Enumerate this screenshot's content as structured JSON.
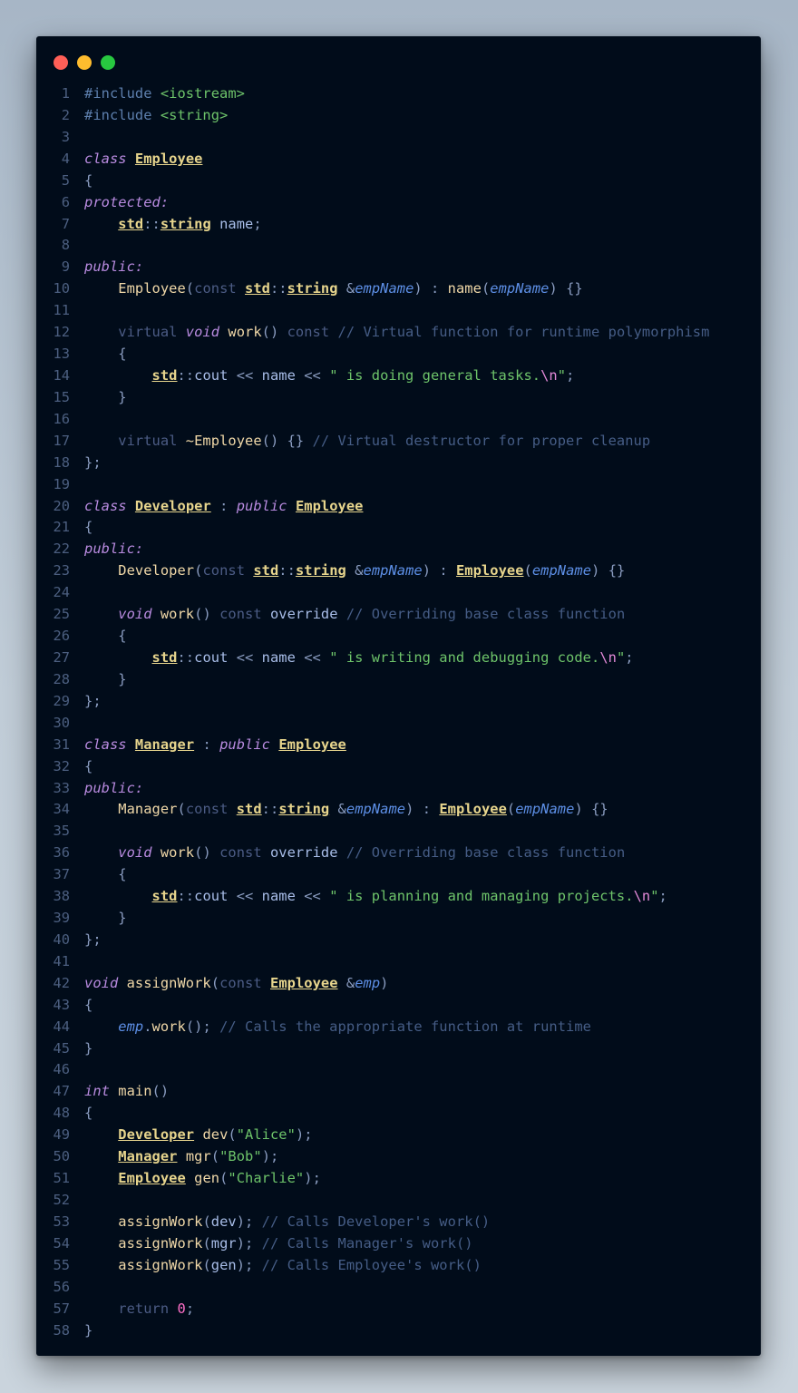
{
  "window": {
    "controls": [
      "close",
      "minimize",
      "maximize"
    ]
  },
  "colors": {
    "keyword": "#b98be0",
    "type": "#e7d58d",
    "string": "#6ec46a",
    "comment": "#465d86",
    "line_number": "#4c5f80",
    "background": "#010c1a"
  },
  "code": {
    "language": "C++",
    "lines": [
      [
        [
          "pp",
          "#include "
        ],
        [
          "inc",
          "<iostream>"
        ]
      ],
      [
        [
          "pp",
          "#include "
        ],
        [
          "inc",
          "<string>"
        ]
      ],
      [],
      [
        [
          "kw",
          "class"
        ],
        [
          "sp",
          " "
        ],
        [
          "ty",
          "Employee"
        ]
      ],
      [
        [
          "pu",
          "{"
        ]
      ],
      [
        [
          "kw",
          "protected:"
        ]
      ],
      [
        [
          "sp",
          "    "
        ],
        [
          "ty",
          "std"
        ],
        [
          "pu",
          "::"
        ],
        [
          "ty",
          "string"
        ],
        [
          "va",
          " name"
        ],
        [
          "pu",
          ";"
        ]
      ],
      [],
      [
        [
          "kw",
          "public:"
        ]
      ],
      [
        [
          "sp",
          "    "
        ],
        [
          "fn",
          "Employee"
        ],
        [
          "pu",
          "("
        ],
        [
          "kw2",
          "const "
        ],
        [
          "ty",
          "std"
        ],
        [
          "pu",
          "::"
        ],
        [
          "ty",
          "string"
        ],
        [
          "sp",
          " "
        ],
        [
          "pu",
          "&"
        ],
        [
          "pa",
          "empName"
        ],
        [
          "pu",
          ") : "
        ],
        [
          "fn",
          "name"
        ],
        [
          "pu",
          "("
        ],
        [
          "pa",
          "empName"
        ],
        [
          "pu",
          ") {}"
        ]
      ],
      [],
      [
        [
          "sp",
          "    "
        ],
        [
          "kw2",
          "virtual "
        ],
        [
          "kw",
          "void"
        ],
        [
          "sp",
          " "
        ],
        [
          "fn",
          "work"
        ],
        [
          "pu",
          "() "
        ],
        [
          "kw2",
          "const "
        ],
        [
          "cm",
          "// Virtual function for runtime polymorphism"
        ]
      ],
      [
        [
          "sp",
          "    "
        ],
        [
          "pu",
          "{"
        ]
      ],
      [
        [
          "sp",
          "        "
        ],
        [
          "ty",
          "std"
        ],
        [
          "pu",
          "::"
        ],
        [
          "va",
          "cout"
        ],
        [
          "pu",
          " << "
        ],
        [
          "va",
          "name"
        ],
        [
          "pu",
          " << "
        ],
        [
          "str",
          "\" is doing general tasks."
        ],
        [
          "esc",
          "\\n"
        ],
        [
          "str",
          "\""
        ],
        [
          "pu",
          ";"
        ]
      ],
      [
        [
          "sp",
          "    "
        ],
        [
          "pu",
          "}"
        ]
      ],
      [],
      [
        [
          "sp",
          "    "
        ],
        [
          "kw2",
          "virtual "
        ],
        [
          "fn",
          "~Employee"
        ],
        [
          "pu",
          "() {} "
        ],
        [
          "cm",
          "// Virtual destructor for proper cleanup"
        ]
      ],
      [
        [
          "pu",
          "};"
        ]
      ],
      [],
      [
        [
          "kw",
          "class"
        ],
        [
          "sp",
          " "
        ],
        [
          "ty",
          "Developer"
        ],
        [
          "pu",
          " : "
        ],
        [
          "kw",
          "public"
        ],
        [
          "sp",
          " "
        ],
        [
          "ty",
          "Employee"
        ]
      ],
      [
        [
          "pu",
          "{"
        ]
      ],
      [
        [
          "kw",
          "public:"
        ]
      ],
      [
        [
          "sp",
          "    "
        ],
        [
          "fn",
          "Developer"
        ],
        [
          "pu",
          "("
        ],
        [
          "kw2",
          "const "
        ],
        [
          "ty",
          "std"
        ],
        [
          "pu",
          "::"
        ],
        [
          "ty",
          "string"
        ],
        [
          "sp",
          " "
        ],
        [
          "pu",
          "&"
        ],
        [
          "pa",
          "empName"
        ],
        [
          "pu",
          ") : "
        ],
        [
          "ty",
          "Employee"
        ],
        [
          "pu",
          "("
        ],
        [
          "pa",
          "empName"
        ],
        [
          "pu",
          ") {}"
        ]
      ],
      [],
      [
        [
          "sp",
          "    "
        ],
        [
          "kw",
          "void"
        ],
        [
          "sp",
          " "
        ],
        [
          "fn",
          "work"
        ],
        [
          "pu",
          "() "
        ],
        [
          "kw2",
          "const "
        ],
        [
          "va",
          "override "
        ],
        [
          "cm",
          "// Overriding base class function"
        ]
      ],
      [
        [
          "sp",
          "    "
        ],
        [
          "pu",
          "{"
        ]
      ],
      [
        [
          "sp",
          "        "
        ],
        [
          "ty",
          "std"
        ],
        [
          "pu",
          "::"
        ],
        [
          "va",
          "cout"
        ],
        [
          "pu",
          " << "
        ],
        [
          "va",
          "name"
        ],
        [
          "pu",
          " << "
        ],
        [
          "str",
          "\" is writing and debugging code."
        ],
        [
          "esc",
          "\\n"
        ],
        [
          "str",
          "\""
        ],
        [
          "pu",
          ";"
        ]
      ],
      [
        [
          "sp",
          "    "
        ],
        [
          "pu",
          "}"
        ]
      ],
      [
        [
          "pu",
          "};"
        ]
      ],
      [],
      [
        [
          "kw",
          "class"
        ],
        [
          "sp",
          " "
        ],
        [
          "ty",
          "Manager"
        ],
        [
          "pu",
          " : "
        ],
        [
          "kw",
          "public"
        ],
        [
          "sp",
          " "
        ],
        [
          "ty",
          "Employee"
        ]
      ],
      [
        [
          "pu",
          "{"
        ]
      ],
      [
        [
          "kw",
          "public:"
        ]
      ],
      [
        [
          "sp",
          "    "
        ],
        [
          "fn",
          "Manager"
        ],
        [
          "pu",
          "("
        ],
        [
          "kw2",
          "const "
        ],
        [
          "ty",
          "std"
        ],
        [
          "pu",
          "::"
        ],
        [
          "ty",
          "string"
        ],
        [
          "sp",
          " "
        ],
        [
          "pu",
          "&"
        ],
        [
          "pa",
          "empName"
        ],
        [
          "pu",
          ") : "
        ],
        [
          "ty",
          "Employee"
        ],
        [
          "pu",
          "("
        ],
        [
          "pa",
          "empName"
        ],
        [
          "pu",
          ") {}"
        ]
      ],
      [],
      [
        [
          "sp",
          "    "
        ],
        [
          "kw",
          "void"
        ],
        [
          "sp",
          " "
        ],
        [
          "fn",
          "work"
        ],
        [
          "pu",
          "() "
        ],
        [
          "kw2",
          "const "
        ],
        [
          "va",
          "override "
        ],
        [
          "cm",
          "// Overriding base class function"
        ]
      ],
      [
        [
          "sp",
          "    "
        ],
        [
          "pu",
          "{"
        ]
      ],
      [
        [
          "sp",
          "        "
        ],
        [
          "ty",
          "std"
        ],
        [
          "pu",
          "::"
        ],
        [
          "va",
          "cout"
        ],
        [
          "pu",
          " << "
        ],
        [
          "va",
          "name"
        ],
        [
          "pu",
          " << "
        ],
        [
          "str",
          "\" is planning and managing projects."
        ],
        [
          "esc",
          "\\n"
        ],
        [
          "str",
          "\""
        ],
        [
          "pu",
          ";"
        ]
      ],
      [
        [
          "sp",
          "    "
        ],
        [
          "pu",
          "}"
        ]
      ],
      [
        [
          "pu",
          "};"
        ]
      ],
      [],
      [
        [
          "kw",
          "void"
        ],
        [
          "sp",
          " "
        ],
        [
          "fn",
          "assignWork"
        ],
        [
          "pu",
          "("
        ],
        [
          "kw2",
          "const "
        ],
        [
          "ty",
          "Employee"
        ],
        [
          "sp",
          " "
        ],
        [
          "pu",
          "&"
        ],
        [
          "pa",
          "emp"
        ],
        [
          "pu",
          ")"
        ]
      ],
      [
        [
          "pu",
          "{"
        ]
      ],
      [
        [
          "sp",
          "    "
        ],
        [
          "pa",
          "emp"
        ],
        [
          "pu",
          "."
        ],
        [
          "fn",
          "work"
        ],
        [
          "pu",
          "(); "
        ],
        [
          "cm",
          "// Calls the appropriate function at runtime"
        ]
      ],
      [
        [
          "pu",
          "}"
        ]
      ],
      [],
      [
        [
          "kw",
          "int"
        ],
        [
          "sp",
          " "
        ],
        [
          "fn",
          "main"
        ],
        [
          "pu",
          "()"
        ]
      ],
      [
        [
          "pu",
          "{"
        ]
      ],
      [
        [
          "sp",
          "    "
        ],
        [
          "ty",
          "Developer"
        ],
        [
          "sp",
          " "
        ],
        [
          "fn",
          "dev"
        ],
        [
          "pu",
          "("
        ],
        [
          "str",
          "\"Alice\""
        ],
        [
          "pu",
          ");"
        ]
      ],
      [
        [
          "sp",
          "    "
        ],
        [
          "ty",
          "Manager"
        ],
        [
          "sp",
          " "
        ],
        [
          "fn",
          "mgr"
        ],
        [
          "pu",
          "("
        ],
        [
          "str",
          "\"Bob\""
        ],
        [
          "pu",
          ");"
        ]
      ],
      [
        [
          "sp",
          "    "
        ],
        [
          "ty",
          "Employee"
        ],
        [
          "sp",
          " "
        ],
        [
          "fn",
          "gen"
        ],
        [
          "pu",
          "("
        ],
        [
          "str",
          "\"Charlie\""
        ],
        [
          "pu",
          ");"
        ]
      ],
      [],
      [
        [
          "sp",
          "    "
        ],
        [
          "fn",
          "assignWork"
        ],
        [
          "pu",
          "("
        ],
        [
          "va",
          "dev"
        ],
        [
          "pu",
          "); "
        ],
        [
          "cm",
          "// Calls Developer's work()"
        ]
      ],
      [
        [
          "sp",
          "    "
        ],
        [
          "fn",
          "assignWork"
        ],
        [
          "pu",
          "("
        ],
        [
          "va",
          "mgr"
        ],
        [
          "pu",
          "); "
        ],
        [
          "cm",
          "// Calls Manager's work()"
        ]
      ],
      [
        [
          "sp",
          "    "
        ],
        [
          "fn",
          "assignWork"
        ],
        [
          "pu",
          "("
        ],
        [
          "va",
          "gen"
        ],
        [
          "pu",
          "); "
        ],
        [
          "cm",
          "// Calls Employee's work()"
        ]
      ],
      [],
      [
        [
          "sp",
          "    "
        ],
        [
          "kw2",
          "return "
        ],
        [
          "num",
          "0"
        ],
        [
          "pu",
          ";"
        ]
      ],
      [
        [
          "pu",
          "}"
        ]
      ]
    ]
  }
}
